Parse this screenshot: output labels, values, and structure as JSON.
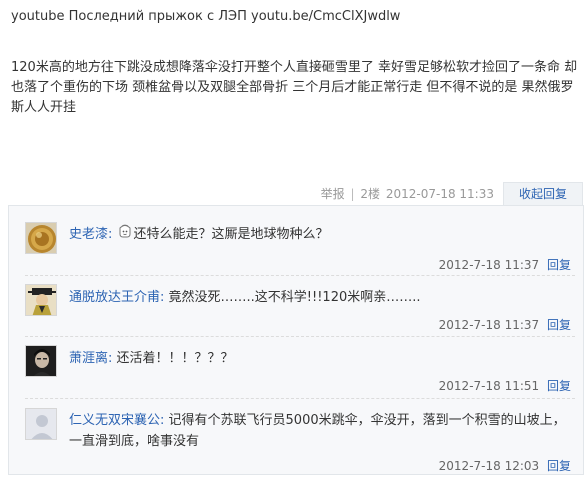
{
  "post": {
    "title": "youtube Последний прыжок с ЛЭП youtu.be/CmcClXJwdlw",
    "body": "120米高的地方往下跳没成想降落伞没打开整个人直接砸雪里了 幸好雪足够松软才捡回了一条命 却也落了个重伤的下场 颈椎盆骨以及双腿全部骨折 三个月后才能正常行走 但不得不说的是 果然俄罗斯人人开挂"
  },
  "meta": {
    "report": "举报",
    "separator": "|",
    "floor": "2楼",
    "datetime": "2012-07-18 11:33",
    "collapse": "收起回复"
  },
  "replies": [
    {
      "user": "史老漆:",
      "text": "还特么能走？这厮是地球物种么？",
      "emoji": "bubble-face-icon",
      "time": "2012-7-18 11:37",
      "reply": "回复"
    },
    {
      "user": "通脱放达王介甫:",
      "text": "竟然没死……..这不科学!!!120米啊亲……..",
      "time": "2012-7-18 11:37",
      "reply": "回复"
    },
    {
      "user": "萧涯离:",
      "text": "还活着！！！？？？",
      "time": "2012-7-18 11:51",
      "reply": "回复"
    },
    {
      "user": "仁义无双宋襄公:",
      "text": "记得有个苏联飞行员5000米跳伞，伞没开，落到一个积雪的山坡上，一直滑到底，啥事没有",
      "time": "2012-7-18 12:03",
      "reply": "回复"
    }
  ],
  "colors": {
    "link": "#2d64b3",
    "reply_bg": "#f7f8fa",
    "border": "#e2e6ea"
  }
}
